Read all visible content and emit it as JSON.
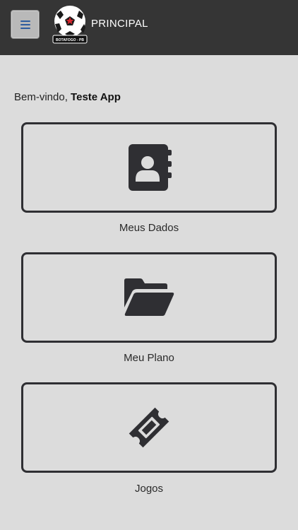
{
  "header": {
    "title": "PRINCIPAL",
    "menu_icon": "hamburger-menu-icon",
    "logo_text": "BOTAFOGO - PB",
    "colors": {
      "bar": "#353535",
      "menu_button": "#b9b9b9",
      "menu_icon": "#2e5d9f"
    }
  },
  "welcome": {
    "greeting": "Bem-vindo,",
    "user_name": "Teste App"
  },
  "cards": [
    {
      "label": "Meus Dados",
      "icon": "address-book-icon"
    },
    {
      "label": "Meu Plano",
      "icon": "folder-open-icon"
    },
    {
      "label": "Jogos",
      "icon": "ticket-icon"
    }
  ],
  "colors": {
    "background": "#dcdcdc",
    "card_border": "#2f2f33",
    "icon": "#2f2f33"
  }
}
